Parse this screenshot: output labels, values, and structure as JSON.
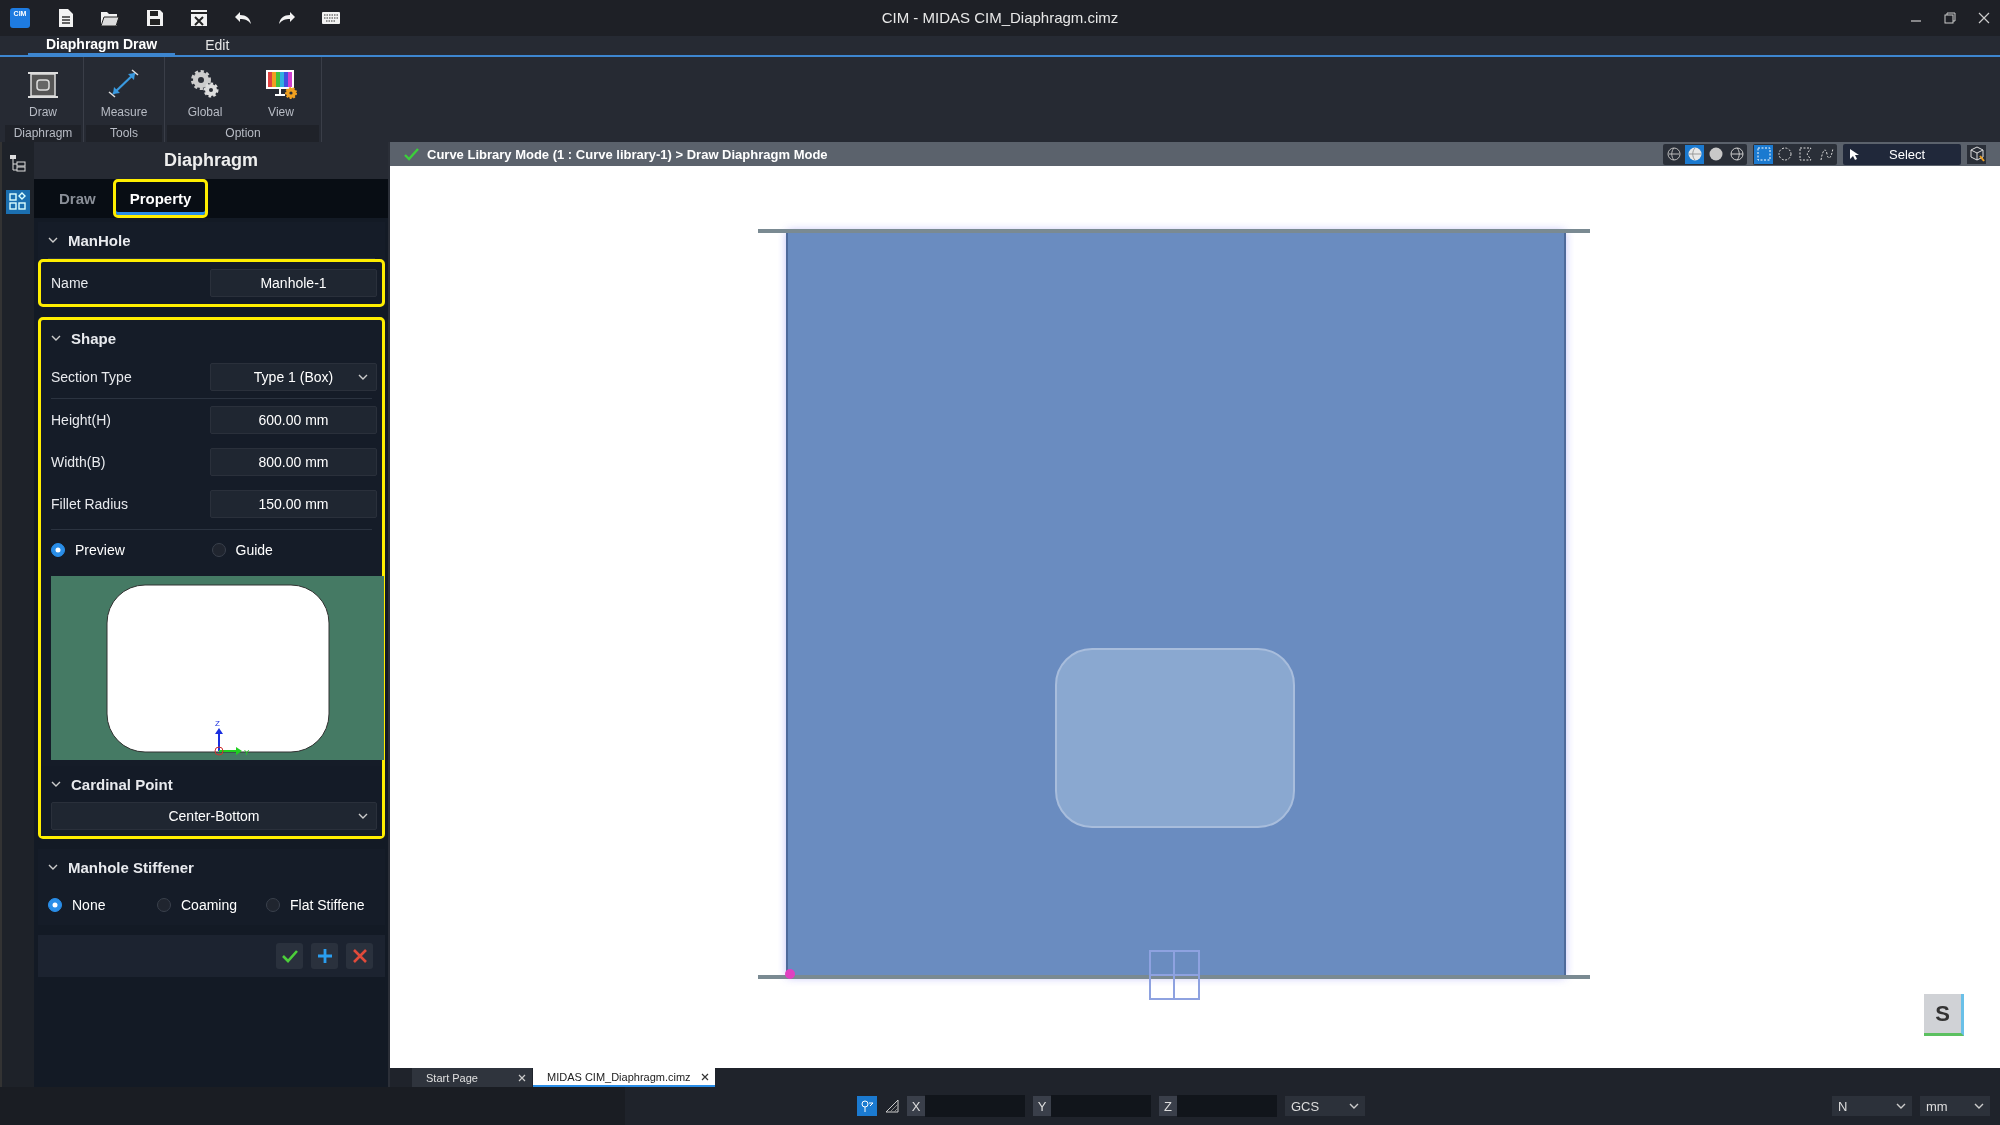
{
  "app": {
    "logo": "CIM",
    "title": "CIM - MIDAS CIM_Diaphragm.cimz"
  },
  "ribbon": {
    "tabs": [
      {
        "label": "Diaphragm Draw",
        "selected": true
      },
      {
        "label": "Edit",
        "selected": false
      }
    ],
    "groups": [
      {
        "label": "Diaphragm",
        "tools": [
          {
            "label": "Draw",
            "kind": "frame"
          }
        ]
      },
      {
        "label": "Tools",
        "tools": [
          {
            "label": "Measure",
            "kind": "measure"
          }
        ]
      },
      {
        "label": "Option",
        "tools": [
          {
            "label": "Global",
            "kind": "gears"
          },
          {
            "label": "View",
            "kind": "monitor"
          }
        ]
      }
    ]
  },
  "panel": {
    "title": "Diaphragm",
    "tabs": [
      {
        "label": "Draw",
        "selected": false,
        "highlighted": false
      },
      {
        "label": "Property",
        "selected": true,
        "highlighted": true
      }
    ],
    "manhole": {
      "title": "ManHole",
      "expanded": true,
      "name_label": "Name",
      "name_value": "Manhole-1",
      "highlighted": true
    },
    "shape": {
      "title": "Shape",
      "expanded": true,
      "highlighted": true,
      "section_type": {
        "label": "Section Type",
        "value": "Type 1 (Box)"
      },
      "fields": [
        {
          "label": "Height(H)",
          "value": "600.00 mm"
        },
        {
          "label": "Width(B)",
          "value": "800.00 mm"
        },
        {
          "label": "Fillet Radius",
          "value": "150.00 mm"
        }
      ],
      "view_options": [
        {
          "label": "Preview",
          "selected": true
        },
        {
          "label": "Guide",
          "selected": false
        }
      ],
      "preview": {
        "axis_z": "Z",
        "axis_y": "Y"
      },
      "cardinal": {
        "title": "Cardinal Point",
        "expanded": true,
        "value": "Center-Bottom"
      }
    },
    "stiffener": {
      "title": "Manhole Stiffener",
      "expanded": true,
      "options": [
        {
          "label": "None",
          "selected": true
        },
        {
          "label": "Coaming",
          "selected": false
        },
        {
          "label": "Flat Stiffene",
          "selected": false
        }
      ]
    },
    "actions": [
      {
        "kind": "confirm"
      },
      {
        "kind": "add"
      },
      {
        "kind": "cancel"
      }
    ]
  },
  "viewport": {
    "breadcrumb": "Curve Library Mode (1 : Curve library-1) > Draw Diaphragm Mode",
    "render_modes": [
      {
        "kind": "auto",
        "selected": false
      },
      {
        "kind": "wire",
        "selected": true
      },
      {
        "kind": "solid",
        "selected": false
      },
      {
        "kind": "hidden",
        "selected": false
      }
    ],
    "selection_modes": [
      {
        "kind": "box",
        "selected": true
      },
      {
        "kind": "circle",
        "selected": false
      },
      {
        "kind": "polygon",
        "selected": false
      },
      {
        "kind": "lasso",
        "selected": false
      }
    ],
    "select_label": "Select",
    "badge": "S"
  },
  "doc_tabs": [
    {
      "label": "Start Page",
      "selected": false
    },
    {
      "label": "MIDAS CIM_Diaphragm.cimz",
      "selected": true
    }
  ],
  "status": {
    "snap_on": true,
    "coords": [
      {
        "axis": "X"
      },
      {
        "axis": "Y"
      },
      {
        "axis": "Z"
      }
    ],
    "system": "GCS",
    "force_unit": "N",
    "length_unit": "mm"
  }
}
